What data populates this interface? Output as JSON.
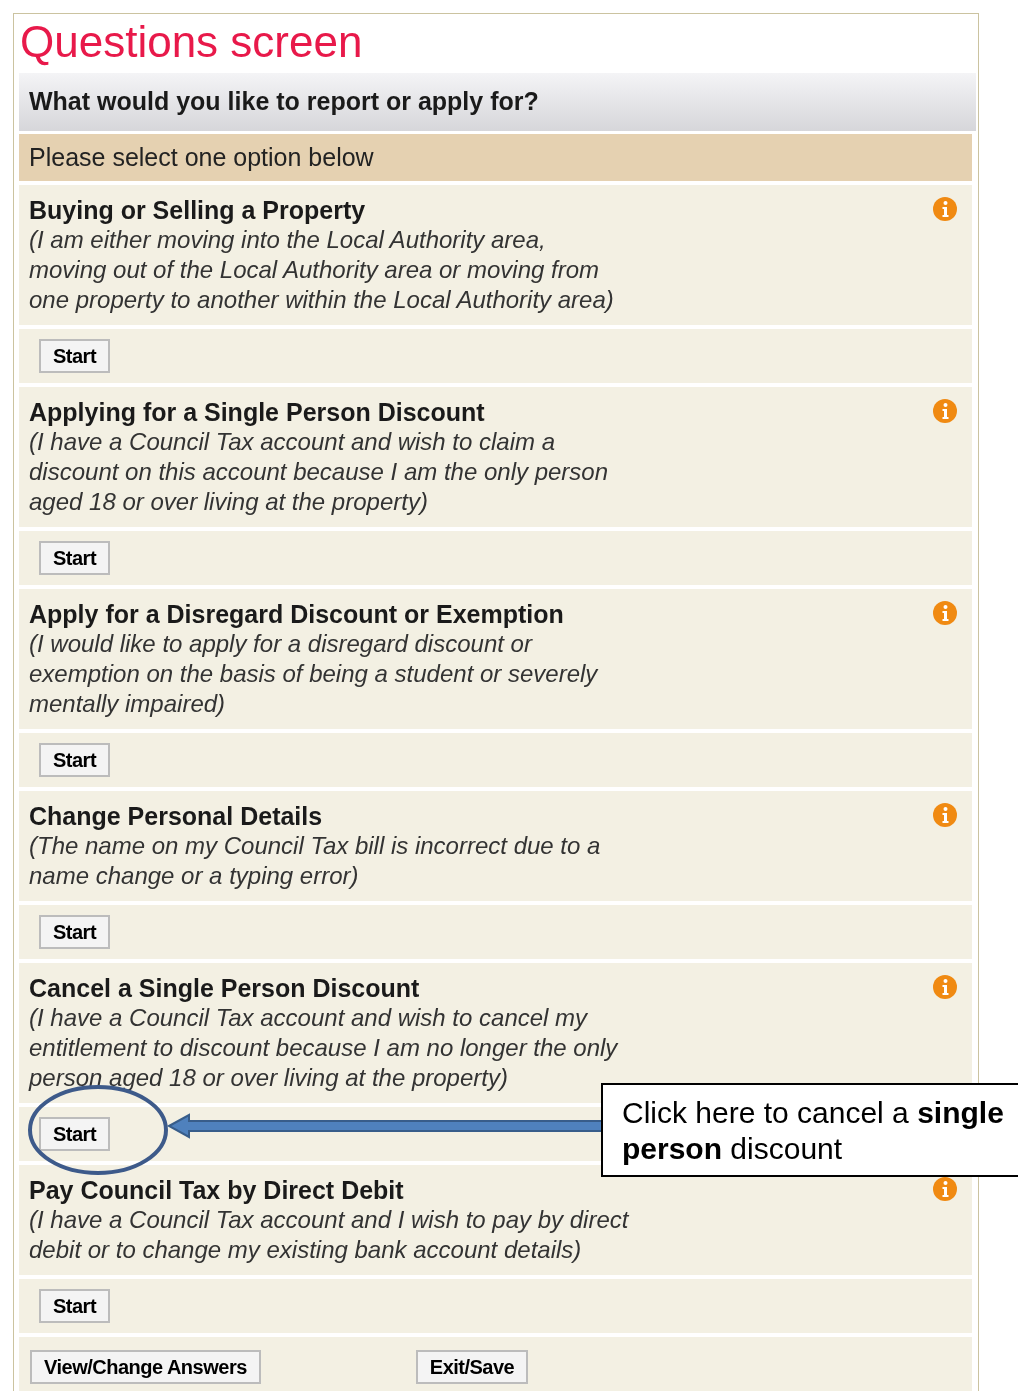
{
  "title": "Questions screen",
  "question": "What would you like to report or apply for?",
  "instruction": "Please select one option below",
  "options": [
    {
      "title": "Buying or Selling a Property",
      "description": [
        "(I am either moving into the Local Authority area,",
        "moving out of the Local Authority area or moving from",
        "one property to another within the Local Authority area)"
      ],
      "button": "Start"
    },
    {
      "title": "Applying for a Single Person Discount",
      "description": [
        "(I have a Council Tax account and wish to claim a",
        "discount on this account because I am the only person",
        "aged 18 or over living at the property)"
      ],
      "button": "Start"
    },
    {
      "title": "Apply for a Disregard Discount or Exemption",
      "description": [
        "(I would like to apply for a disregard discount or",
        "exemption on the basis of being a student or severely",
        "mentally impaired)"
      ],
      "button": "Start"
    },
    {
      "title": "Change Personal Details",
      "description": [
        "(The name on my Council Tax bill is incorrect due to a",
        "name change or a typing error)"
      ],
      "button": "Start"
    },
    {
      "title": "Cancel a Single Person Discount",
      "description": [
        "(I have a Council Tax account and wish to cancel my",
        "entitlement to discount because I am no longer the only",
        "person aged 18 or over living at the property)"
      ],
      "button": "Start",
      "highlighted": true
    },
    {
      "title": "Pay Council Tax by Direct Debit",
      "description": [
        "(I have a Council Tax account and I wish to pay by direct",
        "debit or to change my existing bank account details)"
      ],
      "button": "Start"
    }
  ],
  "footer_buttons": [
    "View/Change Answers",
    "Exit/Save"
  ],
  "callout": {
    "text": "Click here to cancel a **single person** discount"
  }
}
